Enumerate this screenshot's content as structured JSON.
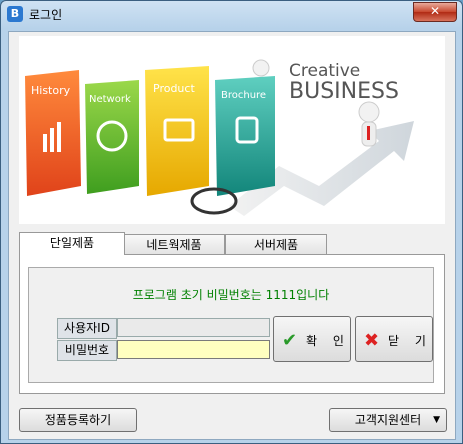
{
  "window": {
    "title": "로그인",
    "app_icon_letter": "B",
    "close_label": "✕"
  },
  "banner": {
    "heading_line1": "Creative",
    "heading_line2": "BUSINESS",
    "cards": [
      "History",
      "Network",
      "Product",
      "Brochure"
    ]
  },
  "tabs": [
    {
      "label": "단일제품",
      "active": true
    },
    {
      "label": "네트웍제품",
      "active": false
    },
    {
      "label": "서버제품",
      "active": false
    }
  ],
  "login": {
    "notice": "프로그램 초기 비밀번호는 1111입니다",
    "user_label": "사용자ID",
    "user_value": "",
    "password_label": "비밀번호",
    "password_value": ""
  },
  "buttons": {
    "confirm": "확 인",
    "close": "닫 기",
    "register": "정품등록하기",
    "support": "고객지원센터"
  },
  "colors": {
    "notice": "#008000",
    "password_field": "#ffffc0",
    "close_button": "#c7462d"
  }
}
